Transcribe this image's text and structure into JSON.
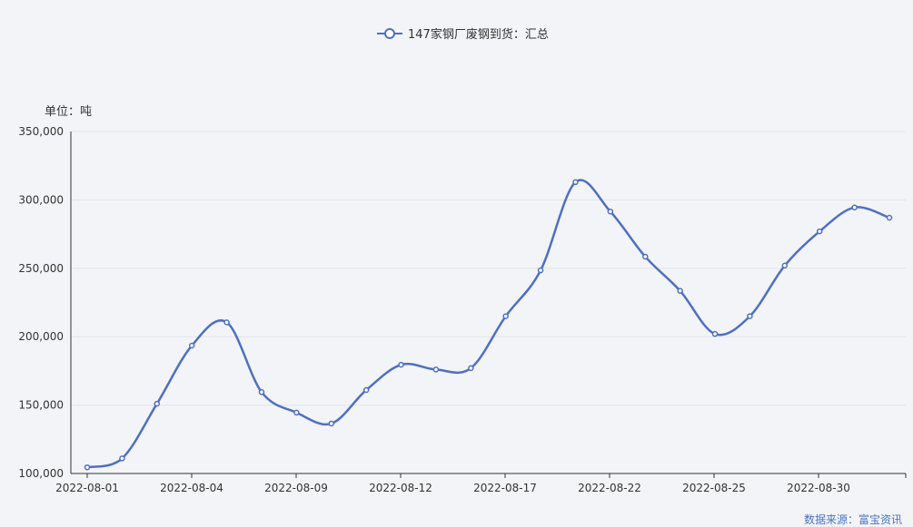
{
  "chart_data": {
    "type": "line",
    "series": [
      {
        "name": "147家钢厂废钢到货：汇总",
        "color": "#4f6fc5",
        "values": [
          104500,
          111000,
          151000,
          193500,
          210500,
          159500,
          144500,
          136500,
          161000,
          179500,
          176000,
          177000,
          215000,
          248500,
          313000,
          291500,
          258500,
          233500,
          202000,
          215000,
          252000,
          277000,
          294500,
          287000
        ]
      }
    ],
    "x_tick_labels": [
      "2022-08-01",
      "2022-08-04",
      "2022-08-09",
      "2022-08-12",
      "2022-08-17",
      "2022-08-22",
      "2022-08-25",
      "2022-08-30"
    ],
    "y_tick_labels": [
      "100,000",
      "150,000",
      "200,000",
      "250,000",
      "300,000",
      "350,000"
    ],
    "ylim": [
      100000,
      350000
    ],
    "y_ticks": [
      100000,
      150000,
      200000,
      250000,
      300000,
      350000
    ],
    "y_unit": "单位：吨",
    "legend_position": "top-center",
    "grid": true,
    "source": "数据来源：富宝资讯"
  }
}
